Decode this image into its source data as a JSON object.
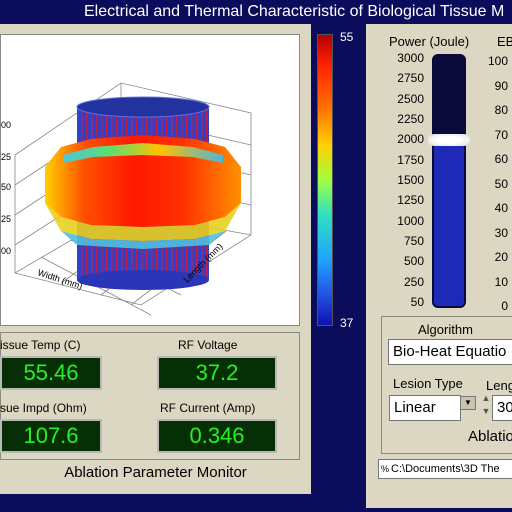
{
  "window": {
    "title": "Electrical and Thermal Characteristic of Biological Tissue M"
  },
  "plot": {
    "z_ticks": [
      "00",
      "25",
      "50",
      "25",
      "00"
    ],
    "x_axis_label": "Width (mm)",
    "y_axis_label": "Length (mm)"
  },
  "colorbar": {
    "max": "55",
    "min": "37"
  },
  "readouts": {
    "tissue_temp": {
      "label": "issue Temp (C)",
      "value": "55.46"
    },
    "rf_voltage": {
      "label": "RF Voltage",
      "value": "37.2"
    },
    "tissue_impd": {
      "label": "sue Impd (Ohm)",
      "value": "107.6"
    },
    "rf_current": {
      "label": "RF Current (Amp)",
      "value": "0.346"
    }
  },
  "monitor_label": "Ablation Parameter Monitor",
  "power": {
    "label": "Power (Joule)",
    "ticks": [
      "3000",
      "2750",
      "2500",
      "2250",
      "2000",
      "1750",
      "1500",
      "1250",
      "1000",
      "750",
      "500",
      "250",
      "50"
    ],
    "value": 2000,
    "range": [
      50,
      3000
    ]
  },
  "ebi": {
    "label": "EB",
    "ticks": [
      "100",
      "90",
      "80",
      "70",
      "60",
      "50",
      "40",
      "30",
      "20",
      "10",
      "0"
    ]
  },
  "algorithm": {
    "label": "Algorithm",
    "value": "Bio-Heat Equatio",
    "lesion_type_label": "Lesion Type",
    "lesion_type_value": "Linear",
    "length_label": "Leng",
    "length_value": "30",
    "ablation_label": "Ablatio"
  },
  "path": {
    "text": "C:\\Documents\\3D The"
  },
  "colors": {
    "background": "#0c0c5c",
    "panel": "#dcd7c3",
    "lcd_bg": "#062f06",
    "lcd_text": "#28f028",
    "slider_fill": "#1f29b8"
  }
}
